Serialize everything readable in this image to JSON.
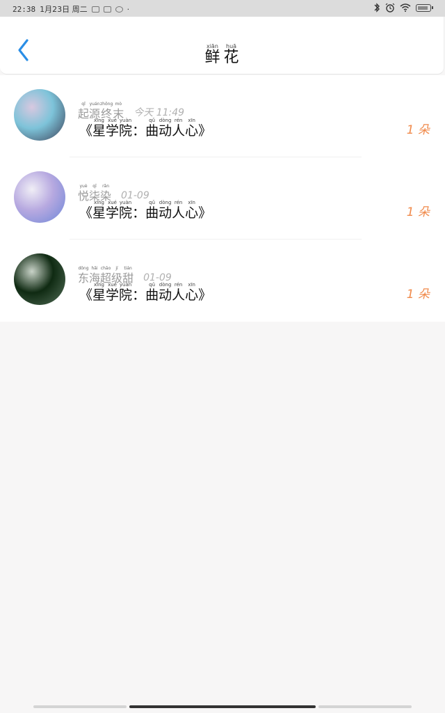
{
  "status_bar": {
    "time": "22:38",
    "date": "1月23日 周二",
    "dot": "·"
  },
  "header": {
    "title_chars": [
      {
        "py": "xiān",
        "hz": "鲜"
      },
      {
        "py": "huā",
        "hz": "花"
      }
    ]
  },
  "items": [
    {
      "name": [
        {
          "py": "qǐ",
          "hz": "起"
        },
        {
          "py": "yuán",
          "hz": "源"
        },
        {
          "py": "zhōng",
          "hz": "终"
        },
        {
          "py": "mò",
          "hz": "末"
        }
      ],
      "time": "今天 11:49",
      "book": [
        "《",
        {
          "py": "xīng",
          "hz": "星"
        },
        {
          "py": "xué",
          "hz": "学"
        },
        {
          "py": "yuàn",
          "hz": "院"
        },
        "：",
        {
          "py": "qǔ",
          "hz": "曲"
        },
        {
          "py": "dòng",
          "hz": "动"
        },
        {
          "py": "rén",
          "hz": "人"
        },
        {
          "py": "xīn",
          "hz": "心"
        },
        "》"
      ],
      "count": "1 朵",
      "avatar_colors": [
        "#7dc3d9",
        "#3a3f56",
        "#d8c8e0"
      ]
    },
    {
      "name": [
        {
          "py": "yuè",
          "hz": "悦"
        },
        {
          "py": "qī",
          "hz": "柒"
        },
        {
          "py": "rǎn",
          "hz": "染"
        }
      ],
      "time": "01-09",
      "book": [
        "《",
        {
          "py": "xīng",
          "hz": "星"
        },
        {
          "py": "xué",
          "hz": "学"
        },
        {
          "py": "yuàn",
          "hz": "院"
        },
        "：",
        {
          "py": "qǔ",
          "hz": "曲"
        },
        {
          "py": "dòng",
          "hz": "动"
        },
        {
          "py": "rén",
          "hz": "人"
        },
        {
          "py": "xīn",
          "hz": "心"
        },
        "》"
      ],
      "count": "1 朵",
      "avatar_colors": [
        "#b7a9e0",
        "#6c86d8",
        "#f0eef6"
      ]
    },
    {
      "name": [
        {
          "py": "dōng",
          "hz": "东"
        },
        {
          "py": "hǎi",
          "hz": "海"
        },
        {
          "py": "chāo",
          "hz": "超"
        },
        {
          "py": "jí",
          "hz": "级"
        },
        {
          "py": "tián",
          "hz": "甜"
        }
      ],
      "time": "01-09",
      "book": [
        "《",
        {
          "py": "xīng",
          "hz": "星"
        },
        {
          "py": "xué",
          "hz": "学"
        },
        {
          "py": "yuàn",
          "hz": "院"
        },
        "：",
        {
          "py": "qǔ",
          "hz": "曲"
        },
        {
          "py": "dòng",
          "hz": "动"
        },
        {
          "py": "rén",
          "hz": "人"
        },
        {
          "py": "xīn",
          "hz": "心"
        },
        "》"
      ],
      "count": "1 朵",
      "avatar_colors": [
        "#0f2a12",
        "#55705a",
        "#c9d3c8"
      ]
    }
  ],
  "colors": {
    "accent_blue": "#2a8ee6",
    "count_orange": "#f08a4b"
  }
}
